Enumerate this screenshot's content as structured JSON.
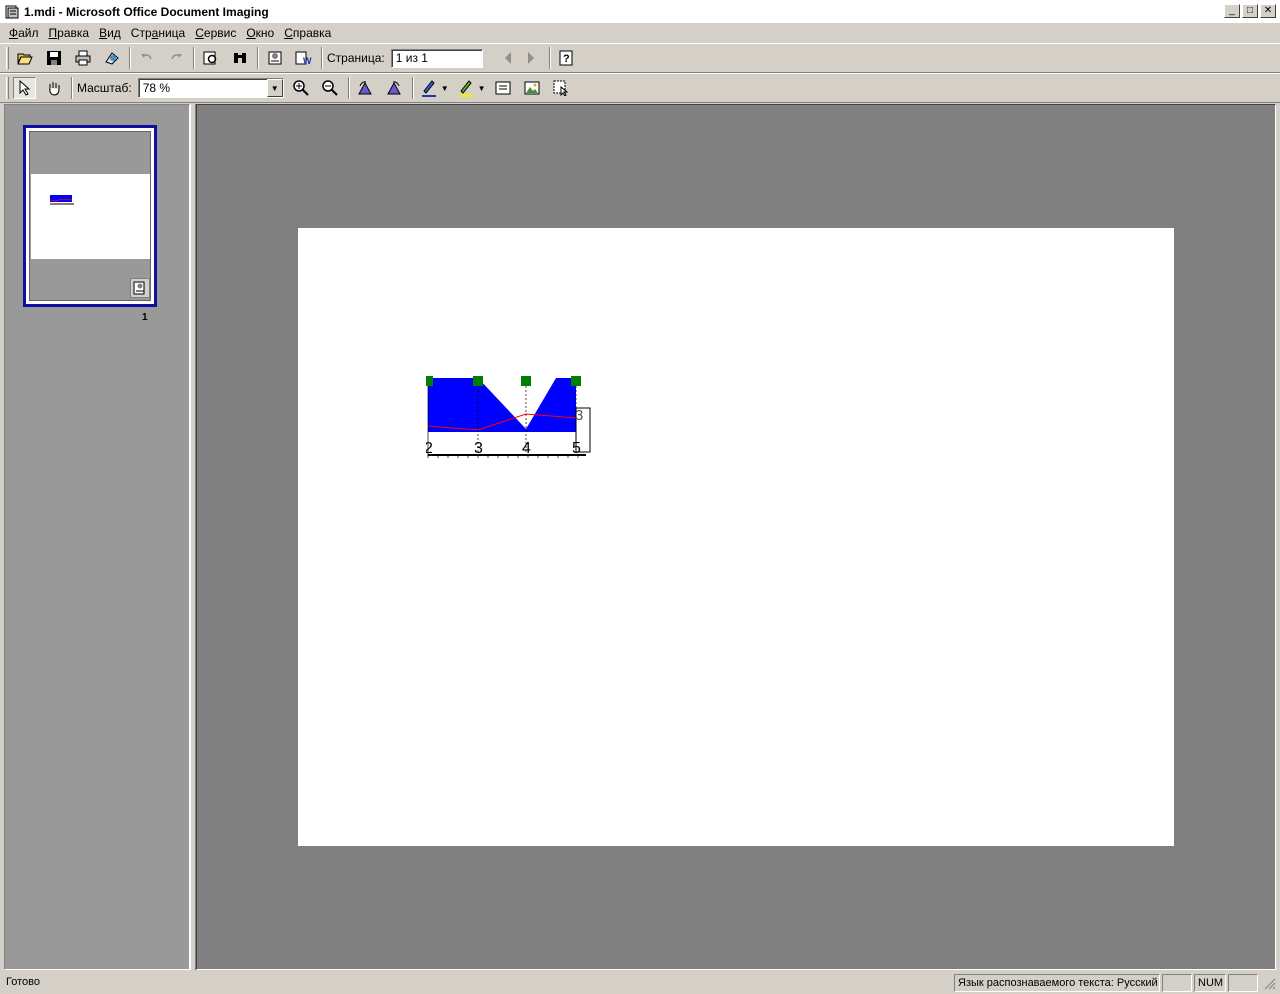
{
  "window": {
    "title": "1.mdi - Microsoft Office Document Imaging",
    "minimize": "_",
    "restore": "□",
    "close": "✕"
  },
  "menu": {
    "items": [
      {
        "pre": "",
        "u": "Ф",
        "post": "айл"
      },
      {
        "pre": "",
        "u": "П",
        "post": "равка"
      },
      {
        "pre": "",
        "u": "В",
        "post": "ид"
      },
      {
        "pre": "Стр",
        "u": "а",
        "post": "ница"
      },
      {
        "pre": "",
        "u": "С",
        "post": "ервис"
      },
      {
        "pre": "",
        "u": "О",
        "post": "кно"
      },
      {
        "pre": "",
        "u": "С",
        "post": "правка"
      }
    ]
  },
  "toolbar1": {
    "icons": [
      "open-icon",
      "save-icon",
      "print-icon",
      "send-icon",
      "undo-icon",
      "redo-icon",
      "find-icon",
      "binoculars-icon",
      "ocr-icon",
      "send-to-word-icon"
    ],
    "page_label": "Страница:",
    "page_value": "1 из 1",
    "help_icon": "help-icon"
  },
  "toolbar2": {
    "zoom_label": "Масштаб:",
    "zoom_value": "78 %"
  },
  "thumbnails": {
    "page_number": "1"
  },
  "chart_data": {
    "type": "area",
    "categories": [
      "2",
      "3",
      "4",
      "5"
    ],
    "fill_color": "#0000ff",
    "line_color": "#ff0000",
    "marker_color": "#008000",
    "side_label": "3"
  },
  "status": {
    "left": "Готово",
    "ocr_language": "Язык распознаваемого текста: Русский",
    "empty1": "",
    "num": "NUM",
    "empty2": ""
  }
}
